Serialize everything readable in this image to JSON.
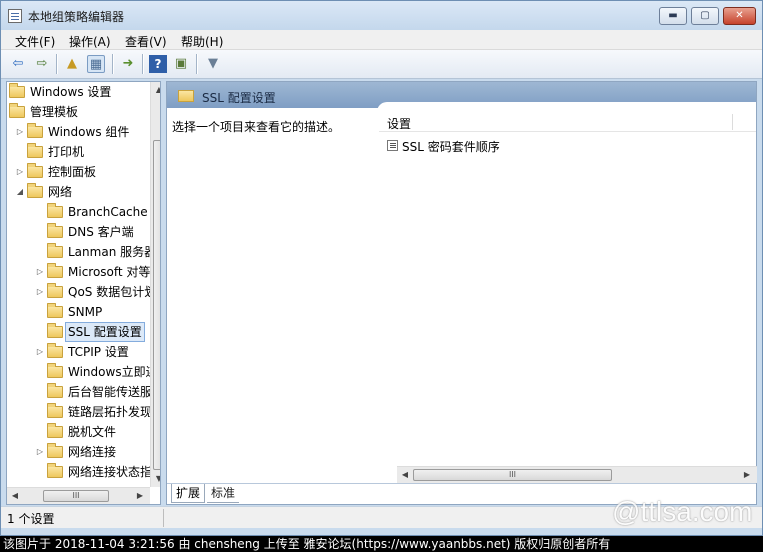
{
  "window": {
    "title": "本地组策略编辑器",
    "min_label": "▬",
    "max_label": "▢",
    "close_label": "✕"
  },
  "menu": [
    {
      "label": "文件(F)"
    },
    {
      "label": "操作(A)"
    },
    {
      "label": "查看(V)"
    },
    {
      "label": "帮助(H)"
    }
  ],
  "toolbar": [
    {
      "icon": "back-arrow-icon",
      "glyph": "⇦",
      "color": "#2f6cc0"
    },
    {
      "icon": "forward-arrow-icon",
      "glyph": "⇨",
      "color": "#4f7b36"
    },
    {
      "icon": "up-folder-icon",
      "glyph": "▲",
      "color": "#c79a24"
    },
    {
      "icon": "show-hide-tree-icon",
      "glyph": "▦",
      "color": "#4a6c94"
    },
    {
      "icon": "export-list-icon",
      "glyph": "➜",
      "color": "#5a8f2e"
    },
    {
      "icon": "help-icon",
      "glyph": "?",
      "color": "#ffffff"
    },
    {
      "icon": "properties-icon",
      "glyph": "▣",
      "color": "#5a7a3a"
    },
    {
      "icon": "filter-icon",
      "glyph": "▼",
      "color": "#6a7f96"
    }
  ],
  "tree": [
    {
      "label": "Windows 设置",
      "depth": 0,
      "expander": ""
    },
    {
      "label": "管理模板",
      "depth": 0,
      "expander": ""
    },
    {
      "label": "Windows 组件",
      "depth": 1,
      "expander": "▷"
    },
    {
      "label": "打印机",
      "depth": 1,
      "expander": ""
    },
    {
      "label": "控制面板",
      "depth": 1,
      "expander": "▷"
    },
    {
      "label": "网络",
      "depth": 1,
      "expander": "◢"
    },
    {
      "label": "BranchCache",
      "depth": 2,
      "expander": ""
    },
    {
      "label": "DNS 客户端",
      "depth": 2,
      "expander": ""
    },
    {
      "label": "Lanman 服务器",
      "depth": 2,
      "expander": ""
    },
    {
      "label": "Microsoft 对等",
      "depth": 2,
      "expander": "▷"
    },
    {
      "label": "QoS 数据包计划",
      "depth": 2,
      "expander": "▷"
    },
    {
      "label": "SNMP",
      "depth": 2,
      "expander": ""
    },
    {
      "label": "SSL 配置设置",
      "depth": 2,
      "expander": "",
      "selected": true
    },
    {
      "label": "TCPIP 设置",
      "depth": 2,
      "expander": "▷"
    },
    {
      "label": "Windows立即连接",
      "depth": 2,
      "expander": ""
    },
    {
      "label": "后台智能传送服务",
      "depth": 2,
      "expander": ""
    },
    {
      "label": "链路层拓扑发现",
      "depth": 2,
      "expander": ""
    },
    {
      "label": "脱机文件",
      "depth": 2,
      "expander": ""
    },
    {
      "label": "网络连接",
      "depth": 2,
      "expander": "▷"
    },
    {
      "label": "网络连接状态指示器",
      "depth": 2,
      "expander": ""
    }
  ],
  "scroll": {
    "left_h_thumb_grip": "III",
    "right_h_thumb_grip": "III",
    "up": "▲",
    "down": "▼",
    "left": "◀",
    "right": "▶"
  },
  "right": {
    "header_title": "SSL 配置设置",
    "description": "选择一个项目来查看它的描述。",
    "column_header": "设置",
    "rows": [
      {
        "label": "SSL 密码套件顺序"
      }
    ],
    "tabs": [
      {
        "label": "扩展",
        "active": true
      },
      {
        "label": "标准",
        "active": false
      }
    ]
  },
  "status": {
    "text": "1 个设置"
  },
  "watermark": "@ttlsa.com",
  "credit": "该图片于 2018-11-04 3:21:56 由 chensheng 上传至 雅安论坛(https://www.yaanbbs.net) 版权归原创者所有"
}
